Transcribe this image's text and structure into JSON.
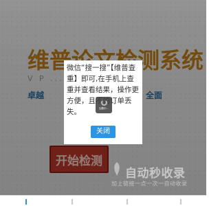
{
  "hero": {
    "title": "维普论文检测系统",
    "subtitle": "V P  ...  E M  6.1",
    "left_tag": "卓越",
    "right_tag": "全面",
    "start_button": "开始检测"
  },
  "modal": {
    "message": "微信“搜一搜”【维普查重】即可,在手机上查重并查看结果，操作更方便，且不怕订单丢失。",
    "close_label": "关闭"
  },
  "toast": {
    "label": "加载中..."
  },
  "watermark": {
    "title": "自动秒收录",
    "subtitle": "加上链接一点一次一自动收录"
  },
  "colors": {
    "overlay": "#000000",
    "modal_button": "#2d93e3",
    "start_button": "#c0392b",
    "hero_title": "#c7811a",
    "tag_text": "#2b6fa6"
  },
  "icons": {
    "bottom_bar": [
      "nav-icon",
      "nav-icon",
      "nav-icon",
      "nav-icon"
    ]
  }
}
